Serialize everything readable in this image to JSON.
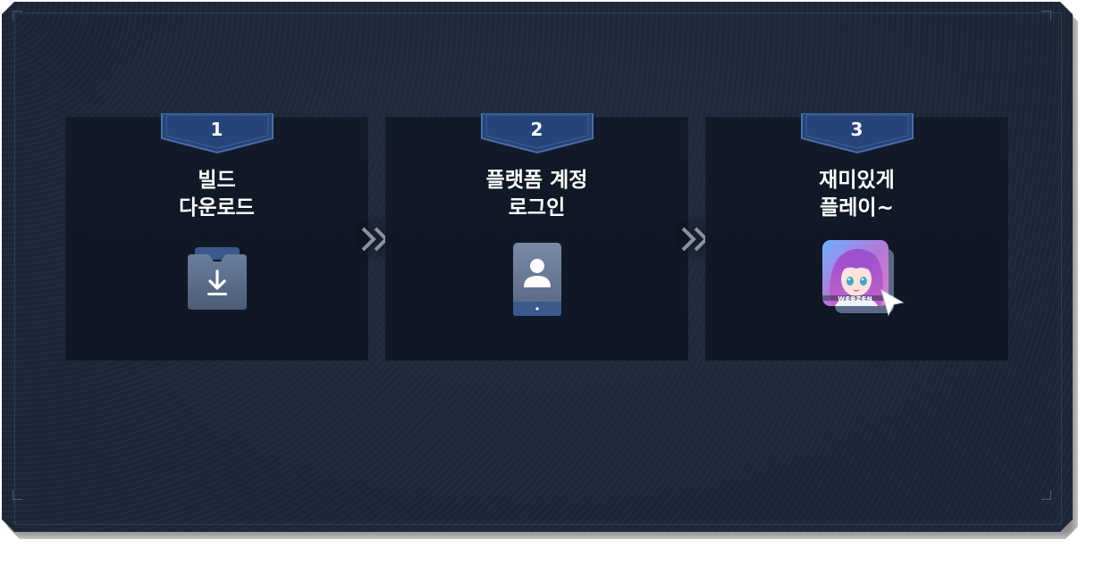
{
  "steps": [
    {
      "number": "1",
      "title_line1": "빌드",
      "title_line2": "다운로드",
      "icon": "download-icon"
    },
    {
      "number": "2",
      "title_line1": "플랫폼 계정",
      "title_line2": "로그인",
      "icon": "account-phone-icon"
    },
    {
      "number": "3",
      "title_line1": "재미있게",
      "title_line2": "플레이~",
      "icon": "game-app-icon"
    }
  ],
  "app_icon_text": "WEBZEN",
  "separators": [
    "chevron-double-right-icon",
    "chevron-double-right-icon"
  ],
  "colors": {
    "panel": "#1d2636",
    "card": "#111927",
    "badge": "#2a4a80",
    "badge_border": "#4a6ea8",
    "icon_bg": "#5a6e8e",
    "arrow": "#8b93a3"
  }
}
